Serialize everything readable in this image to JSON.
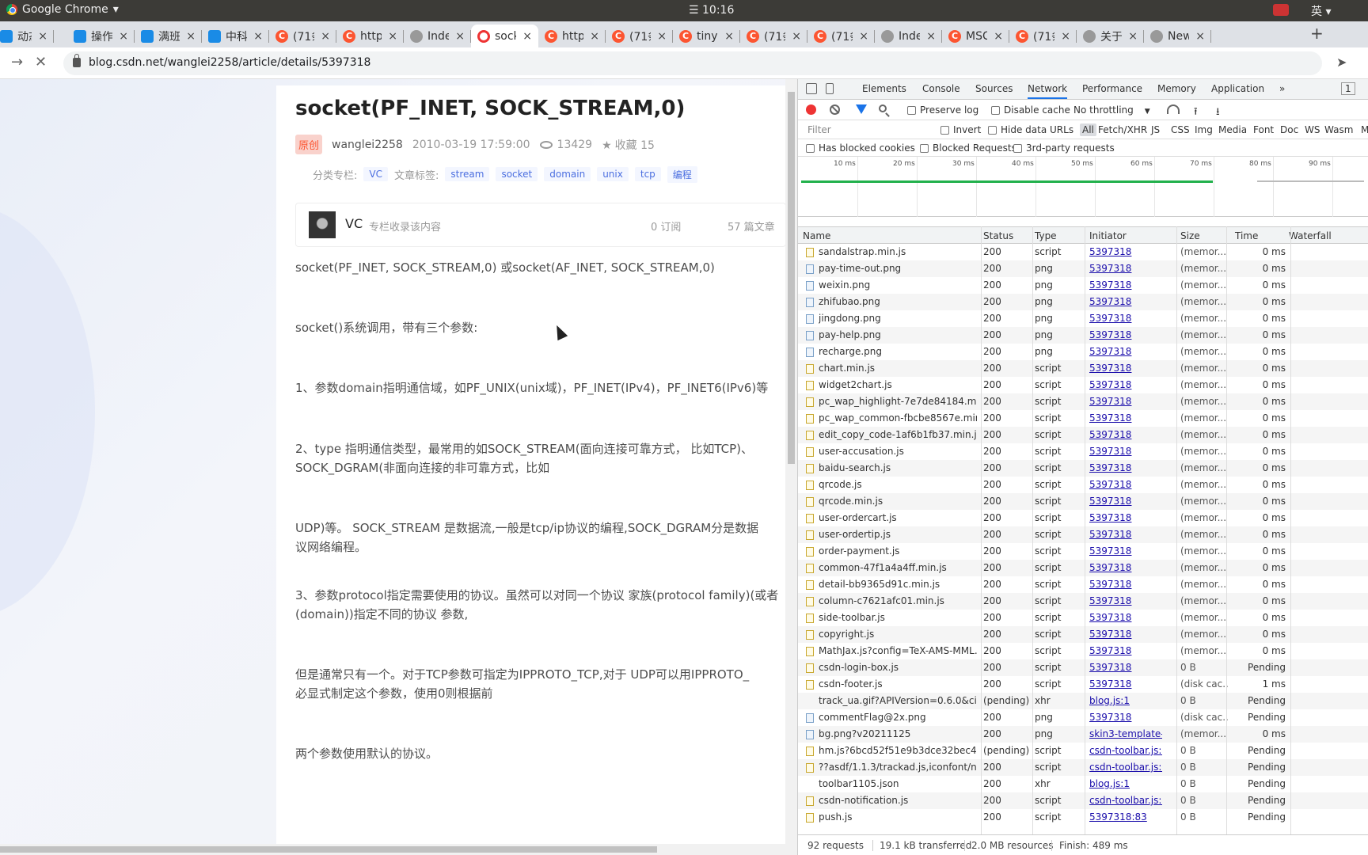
{
  "os": {
    "app_name": "Google Chrome",
    "app_caret": "▾",
    "clock": "☰ 10:16",
    "ime": "英 ▾"
  },
  "tabs": [
    {
      "label": "动态",
      "fav": "b",
      "fav_text": "",
      "active": false
    },
    {
      "label": "操作",
      "fav": "b",
      "fav_text": "",
      "active": false
    },
    {
      "label": "满班",
      "fav": "b",
      "fav_text": "",
      "active": false
    },
    {
      "label": "中科",
      "fav": "b",
      "fav_text": "",
      "active": false
    },
    {
      "label": "(71条",
      "fav": "c",
      "fav_text": "C",
      "active": false
    },
    {
      "label": "http",
      "fav": "c",
      "fav_text": "C",
      "active": false
    },
    {
      "label": "Inde",
      "fav": "g",
      "fav_text": "",
      "active": false
    },
    {
      "label": "sock",
      "fav": "r",
      "fav_text": "",
      "active": true
    },
    {
      "label": "http",
      "fav": "c",
      "fav_text": "C",
      "active": false
    },
    {
      "label": "(71条",
      "fav": "c",
      "fav_text": "C",
      "active": false
    },
    {
      "label": "tiny",
      "fav": "c",
      "fav_text": "C",
      "active": false
    },
    {
      "label": "(71条",
      "fav": "c",
      "fav_text": "C",
      "active": false
    },
    {
      "label": "(71条",
      "fav": "c",
      "fav_text": "C",
      "active": false
    },
    {
      "label": "Inde",
      "fav": "g",
      "fav_text": "",
      "active": false
    },
    {
      "label": "MSC",
      "fav": "c",
      "fav_text": "C",
      "active": false
    },
    {
      "label": "(71条",
      "fav": "c",
      "fav_text": "C",
      "active": false
    },
    {
      "label": "关于",
      "fav": "g",
      "fav_text": "",
      "active": false
    },
    {
      "label": "New",
      "fav": "g",
      "fav_text": "",
      "active": false
    }
  ],
  "tab_close": "×",
  "new_tab": "+",
  "nav": {
    "forward": "→",
    "stop": "✕",
    "url": "blog.csdn.net/wanglei2258/article/details/5397318",
    "send": "➤"
  },
  "article": {
    "title": "socket(PF_INET, SOCK_STREAM,0)",
    "badge": "原创",
    "author": "wanglei2258",
    "date": "2010-03-19 17:59:00",
    "views": "13429",
    "collect": "收藏 15",
    "category_label": "分类专栏:",
    "category": "VC",
    "tags_label": "文章标签:",
    "tags": [
      "stream",
      "socket",
      "domain",
      "unix",
      "tcp",
      "编程"
    ],
    "column": {
      "name": "VC",
      "desc": "专栏收录该内容",
      "subs": "0 订阅",
      "count": "57 篇文章"
    },
    "paragraphs": [
      "socket(PF_INET, SOCK_STREAM,0) 或socket(AF_INET, SOCK_STREAM,0)",
      "socket()系统调用，带有三个参数:",
      "1、参数domain指明通信域，如PF_UNIX(unix域)，PF_INET(IPv4)，PF_INET6(IPv6)等",
      "2、type 指明通信类型，最常用的如SOCK_STREAM(面向连接可靠方式， 比如TCP)、",
      "SOCK_DGRAM(非面向连接的非可靠方式，比如",
      "UDP)等。 SOCK_STREAM 是数据流,一般是tcp/ip协议的编程,SOCK_DGRAM分是数据",
      "议网络编程。",
      "3、参数protocol指定需要使用的协议。虽然可以对同一个协议 家族(protocol family)(或者",
      "(domain))指定不同的协议 参数,",
      "但是通常只有一个。对于TCP参数可指定为IPPROTO_TCP,对于 UDP可以用IPPROTO_",
      "必显式制定这个参数，使用0则根据前",
      "两个参数使用默认的协议。"
    ]
  },
  "devtools": {
    "tabs": [
      "Elements",
      "Console",
      "Sources",
      "Network",
      "Performance",
      "Memory",
      "Application"
    ],
    "more": "»",
    "badge": "1",
    "preserve_log": "Preserve log",
    "disable_cache": "Disable cache",
    "throttle": "No throttling",
    "throttle_caret": "▼",
    "upload": "⭱",
    "download": "⭳",
    "filter_placeholder": "Filter",
    "invert": "Invert",
    "hide_data": "Hide data URLs",
    "types": [
      "All",
      "Fetch/XHR",
      "JS",
      "CSS",
      "Img",
      "Media",
      "Font",
      "Doc",
      "WS",
      "Wasm",
      "M"
    ],
    "blocked_cookies": "Has blocked cookies",
    "blocked_requests": "Blocked Requests",
    "third_party": "3rd-party requests",
    "ticks": [
      "10 ms",
      "20 ms",
      "30 ms",
      "40 ms",
      "50 ms",
      "60 ms",
      "70 ms",
      "80 ms",
      "90 ms"
    ],
    "columns": [
      "Name",
      "Status",
      "Type",
      "Initiator",
      "Size",
      "Time",
      "Waterfall"
    ],
    "rows": [
      {
        "icon": "js",
        "name": "sandalstrap.min.js",
        "status": "200",
        "type": "script",
        "init": "5397318",
        "size": "(memor...",
        "time": "0 ms"
      },
      {
        "icon": "img",
        "name": "pay-time-out.png",
        "status": "200",
        "type": "png",
        "init": "5397318",
        "size": "(memor...",
        "time": "0 ms"
      },
      {
        "icon": "img",
        "name": "weixin.png",
        "status": "200",
        "type": "png",
        "init": "5397318",
        "size": "(memor...",
        "time": "0 ms"
      },
      {
        "icon": "img",
        "name": "zhifubao.png",
        "status": "200",
        "type": "png",
        "init": "5397318",
        "size": "(memor...",
        "time": "0 ms"
      },
      {
        "icon": "img",
        "name": "jingdong.png",
        "status": "200",
        "type": "png",
        "init": "5397318",
        "size": "(memor...",
        "time": "0 ms"
      },
      {
        "icon": "img",
        "name": "pay-help.png",
        "status": "200",
        "type": "png",
        "init": "5397318",
        "size": "(memor...",
        "time": "0 ms"
      },
      {
        "icon": "img",
        "name": "recharge.png",
        "status": "200",
        "type": "png",
        "init": "5397318",
        "size": "(memor...",
        "time": "0 ms"
      },
      {
        "icon": "js",
        "name": "chart.min.js",
        "status": "200",
        "type": "script",
        "init": "5397318",
        "size": "(memor...",
        "time": "0 ms"
      },
      {
        "icon": "js",
        "name": "widget2chart.js",
        "status": "200",
        "type": "script",
        "init": "5397318",
        "size": "(memor...",
        "time": "0 ms"
      },
      {
        "icon": "js",
        "name": "pc_wap_highlight-7e7de84184.mi...",
        "status": "200",
        "type": "script",
        "init": "5397318",
        "size": "(memor...",
        "time": "0 ms"
      },
      {
        "icon": "js",
        "name": "pc_wap_common-fbcbe8567e.min.js",
        "status": "200",
        "type": "script",
        "init": "5397318",
        "size": "(memor...",
        "time": "0 ms"
      },
      {
        "icon": "js",
        "name": "edit_copy_code-1af6b1fb37.min.js",
        "status": "200",
        "type": "script",
        "init": "5397318",
        "size": "(memor...",
        "time": "0 ms"
      },
      {
        "icon": "js",
        "name": "user-accusation.js",
        "status": "200",
        "type": "script",
        "init": "5397318",
        "size": "(memor...",
        "time": "0 ms"
      },
      {
        "icon": "js",
        "name": "baidu-search.js",
        "status": "200",
        "type": "script",
        "init": "5397318",
        "size": "(memor...",
        "time": "0 ms"
      },
      {
        "icon": "js",
        "name": "qrcode.js",
        "status": "200",
        "type": "script",
        "init": "5397318",
        "size": "(memor...",
        "time": "0 ms"
      },
      {
        "icon": "js",
        "name": "qrcode.min.js",
        "status": "200",
        "type": "script",
        "init": "5397318",
        "size": "(memor...",
        "time": "0 ms"
      },
      {
        "icon": "js",
        "name": "user-ordercart.js",
        "status": "200",
        "type": "script",
        "init": "5397318",
        "size": "(memor...",
        "time": "0 ms"
      },
      {
        "icon": "js",
        "name": "user-ordertip.js",
        "status": "200",
        "type": "script",
        "init": "5397318",
        "size": "(memor...",
        "time": "0 ms"
      },
      {
        "icon": "js",
        "name": "order-payment.js",
        "status": "200",
        "type": "script",
        "init": "5397318",
        "size": "(memor...",
        "time": "0 ms"
      },
      {
        "icon": "js",
        "name": "common-47f1a4a4ff.min.js",
        "status": "200",
        "type": "script",
        "init": "5397318",
        "size": "(memor...",
        "time": "0 ms"
      },
      {
        "icon": "js",
        "name": "detail-bb9365d91c.min.js",
        "status": "200",
        "type": "script",
        "init": "5397318",
        "size": "(memor...",
        "time": "0 ms"
      },
      {
        "icon": "js",
        "name": "column-c7621afc01.min.js",
        "status": "200",
        "type": "script",
        "init": "5397318",
        "size": "(memor...",
        "time": "0 ms"
      },
      {
        "icon": "js",
        "name": "side-toolbar.js",
        "status": "200",
        "type": "script",
        "init": "5397318",
        "size": "(memor...",
        "time": "0 ms"
      },
      {
        "icon": "js",
        "name": "copyright.js",
        "status": "200",
        "type": "script",
        "init": "5397318",
        "size": "(memor...",
        "time": "0 ms"
      },
      {
        "icon": "js",
        "name": "MathJax.js?config=TeX-AMS-MML...",
        "status": "200",
        "type": "script",
        "init": "5397318",
        "size": "(memor...",
        "time": "0 ms"
      },
      {
        "icon": "js",
        "name": "csdn-login-box.js",
        "status": "200",
        "type": "script",
        "init": "5397318",
        "size": "0 B",
        "time": "Pending"
      },
      {
        "icon": "js",
        "name": "csdn-footer.js",
        "status": "200",
        "type": "script",
        "init": "5397318",
        "size": "(disk cac...",
        "time": "1 ms"
      },
      {
        "icon": "none",
        "name": "track_ua.gif?APIVersion=0.6.0&cid...",
        "status": "(pending)",
        "type": "xhr",
        "init": "blog.js:1",
        "size": "0 B",
        "time": "Pending"
      },
      {
        "icon": "img",
        "name": "commentFlag@2x.png",
        "status": "200",
        "type": "png",
        "init": "5397318",
        "size": "(disk cac...",
        "time": "Pending"
      },
      {
        "icon": "img",
        "name": "bg.png?v20211125",
        "status": "200",
        "type": "png",
        "init": "skin3-template-c...",
        "size": "(memor...",
        "time": "0 ms"
      },
      {
        "icon": "js",
        "name": "hm.js?6bcd52f51e9b3dce32bec4a...",
        "status": "(pending)",
        "type": "script",
        "init": "csdn-toolbar.js:1",
        "size": "0 B",
        "time": "Pending"
      },
      {
        "icon": "js",
        "name": "??asdf/1.1.3/trackad.js,iconfont/n...",
        "status": "200",
        "type": "script",
        "init": "csdn-toolbar.js:1",
        "size": "0 B",
        "time": "Pending"
      },
      {
        "icon": "none",
        "name": "toolbar1105.json",
        "status": "200",
        "type": "xhr",
        "init": "blog.js:1",
        "size": "0 B",
        "time": "Pending"
      },
      {
        "icon": "js",
        "name": "csdn-notification.js",
        "status": "200",
        "type": "script",
        "init": "csdn-toolbar.js:3",
        "size": "0 B",
        "time": "Pending"
      },
      {
        "icon": "js",
        "name": "push.js",
        "status": "200",
        "type": "script",
        "init": "5397318:83",
        "size": "0 B",
        "time": "Pending"
      }
    ],
    "status_bar": [
      "92 requests",
      "19.1 kB transferred",
      "2.0 MB resources",
      "Finish: 489 ms"
    ]
  }
}
